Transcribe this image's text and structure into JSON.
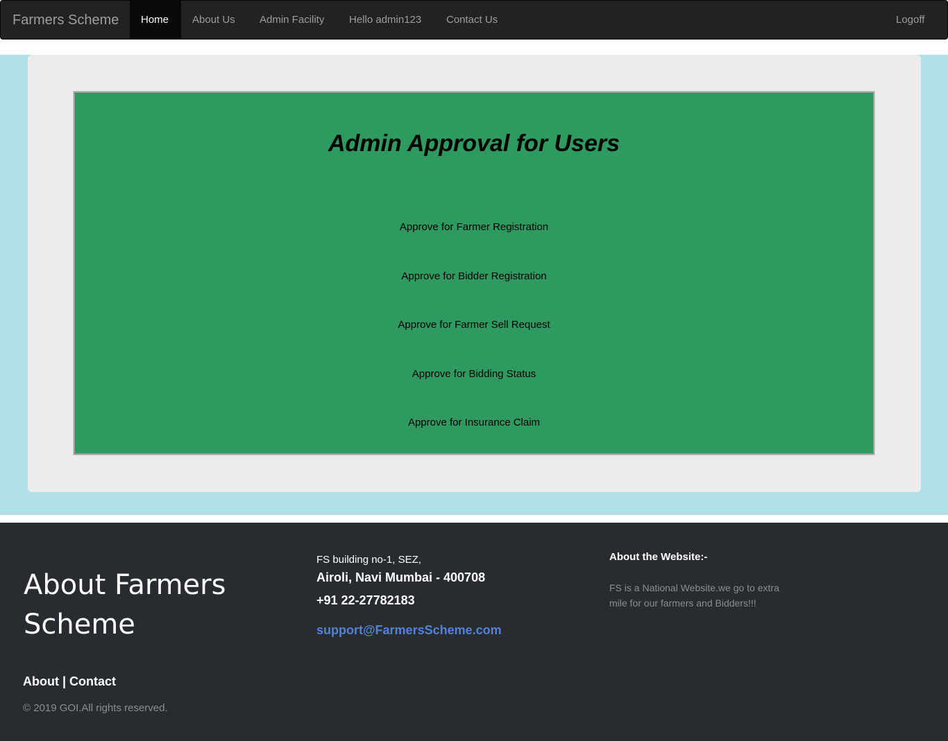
{
  "navbar": {
    "brand": "Farmers Scheme",
    "items": [
      {
        "label": "Home",
        "active": true
      },
      {
        "label": "About Us",
        "active": false
      },
      {
        "label": "Admin Facility",
        "active": false
      },
      {
        "label": "Hello admin123",
        "active": false
      },
      {
        "label": "Contact Us",
        "active": false
      }
    ],
    "logoff": "Logoff"
  },
  "main": {
    "title": "Admin Approval for Users",
    "links": [
      "Approve for Farmer Registration",
      "Approve for Bidder Registration",
      "Approve for Farmer Sell Request",
      "Approve for Bidding Status",
      "Approve for Insurance Claim"
    ]
  },
  "footer": {
    "heading": "About Farmers Scheme",
    "link_about": "About",
    "link_separator": " | ",
    "link_contact": "Contact",
    "copyright": "© 2019 GOI.All rights reserved.",
    "address_line1": "FS building no-1, SEZ,",
    "address_line2": "Airoli, Navi Mumbai - 400708",
    "phone": "+91 22-27782183",
    "email": "support@FarmersScheme.com",
    "about_title": "About the Website:-",
    "about_text": "FS is a National Website.we go to extra mile for our farmers and Bidders!!!"
  },
  "colors": {
    "navbar_bg": "#222222",
    "band_bg": "#b0e0e6",
    "panel_bg": "#ececec",
    "green_box": "#2e9a5f",
    "footer_bg": "#282b2f",
    "email_link": "#5383d3"
  }
}
